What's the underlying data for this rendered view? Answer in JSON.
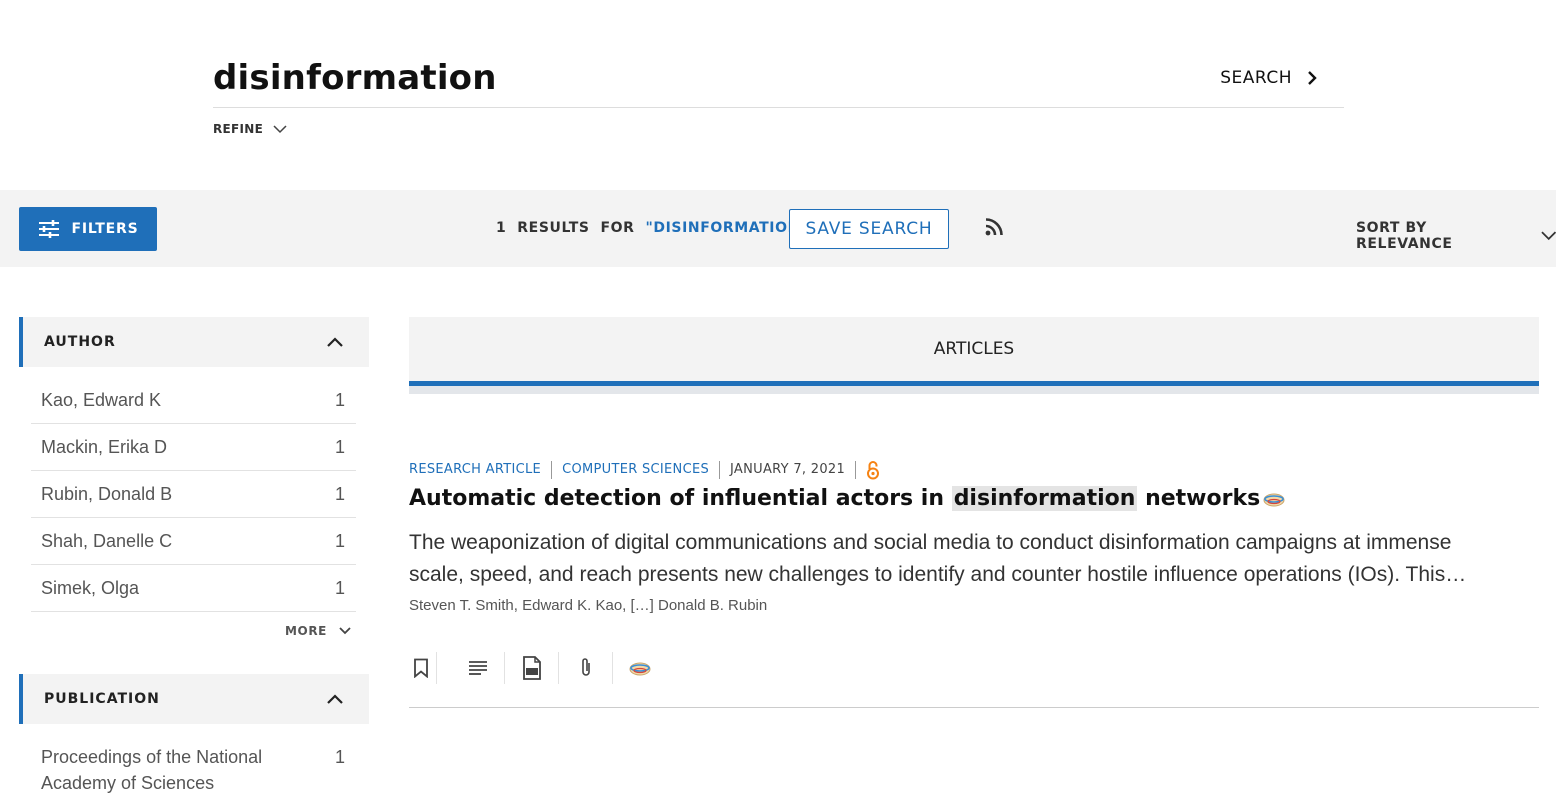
{
  "search": {
    "query": "disinformation",
    "search_label": "SEARCH",
    "refine_label": "REFINE"
  },
  "toolbar": {
    "filters_label": "FILTERS",
    "results_count": "1",
    "results_label": "RESULTS",
    "for_label": "FOR",
    "results_query": "\"DISINFORMATION\"",
    "save_search_label": "SAVE SEARCH",
    "sort_label": "SORT BY RELEVANCE"
  },
  "sidebar": {
    "author": {
      "title": "AUTHOR",
      "items": [
        {
          "label": "Kao, Edward K",
          "count": "1"
        },
        {
          "label": "Mackin, Erika D",
          "count": "1"
        },
        {
          "label": "Rubin, Donald B",
          "count": "1"
        },
        {
          "label": "Shah, Danelle C",
          "count": "1"
        },
        {
          "label": "Simek, Olga",
          "count": "1"
        }
      ],
      "more_label": "MORE"
    },
    "publication": {
      "title": "PUBLICATION",
      "items": [
        {
          "label": "Proceedings of the National Academy of Sciences",
          "count": "1"
        }
      ]
    }
  },
  "main": {
    "tab_label": "ARTICLES",
    "result": {
      "type": "RESEARCH ARTICLE",
      "subject": "COMPUTER SCIENCES",
      "date": "JANUARY 7, 2021",
      "title_before": "Automatic detection of influential actors in ",
      "title_highlight": "disinformation",
      "title_after": " networks",
      "abstract_line1": "The weaponization of digital communications and social media to conduct disinformation campaigns at immense",
      "abstract_line2": "scale, speed, and reach presents new challenges to identify and counter hostile influence operations (IOs). This…",
      "authors": "Steven T. Smith, Edward K. Kao, […] Donald B. Rubin"
    }
  },
  "colors": {
    "accent": "#1f6fb9",
    "open_access": "#f68212",
    "band": "#f3f3f3"
  },
  "icons": [
    "chevron-right-icon",
    "chevron-down-icon",
    "sliders-icon",
    "rss-icon",
    "chevron-up-icon",
    "open-access-icon",
    "altmetric-icon",
    "bookmark-icon",
    "abstract-icon",
    "pdf-icon",
    "paperclip-icon"
  ]
}
